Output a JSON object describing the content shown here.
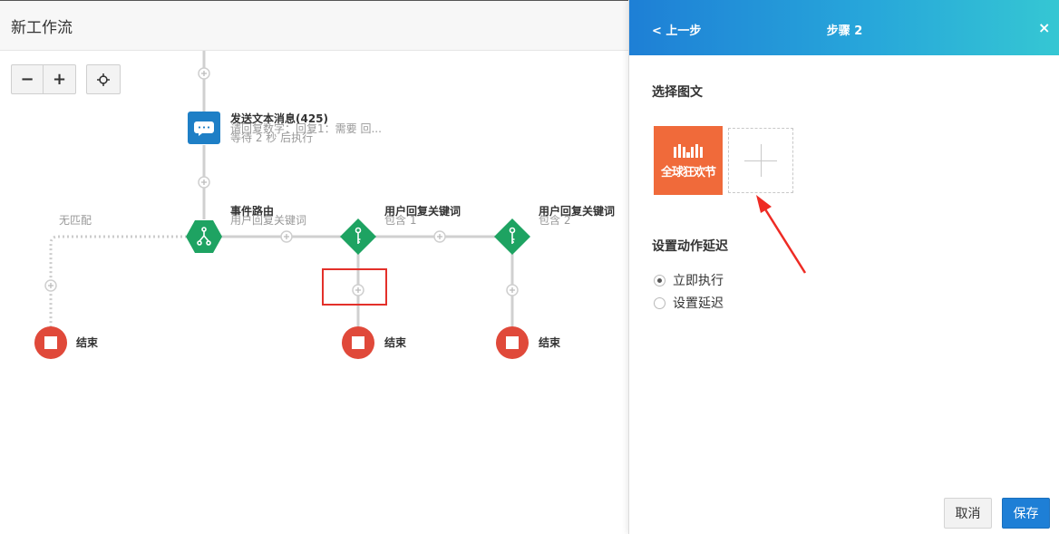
{
  "workflow": {
    "title": "新工作流",
    "controls": {
      "zoom_out": "−",
      "zoom_in": "+"
    },
    "nodes": {
      "send_message": {
        "title": "发送文本消息(425)",
        "detail": "请回复数字：回复1：需要 回...",
        "delay": "等待 2 秒 后执行",
        "icon": "chat-bubble-icon",
        "color": "#1e7fc6"
      },
      "event_router": {
        "title": "事件路由",
        "subtitle": "用户回复关键词",
        "icon": "branch-icon",
        "color": "#1ea362"
      },
      "keyword_1": {
        "title": "用户回复关键词",
        "subtitle": "包含 1",
        "icon": "key-icon",
        "color": "#1ea362"
      },
      "keyword_2": {
        "title": "用户回复关键词",
        "subtitle": "包含 2",
        "icon": "key-icon",
        "color": "#1ea362"
      },
      "no_match_label": "无匹配",
      "end_nodes": [
        {
          "label": "结束",
          "color": "#e0493a"
        },
        {
          "label": "结束",
          "color": "#e0493a"
        },
        {
          "label": "结束",
          "color": "#e0493a"
        }
      ]
    }
  },
  "panel": {
    "back_label": "< 上一步",
    "step_title": "步骤 2",
    "close_label": "×",
    "media_section_title": "选择图文",
    "media_item_text": "全球狂欢节",
    "delay_section_title": "设置动作延迟",
    "delay_options": [
      {
        "label": "立即执行",
        "checked": true
      },
      {
        "label": "设置延迟",
        "checked": false
      }
    ],
    "cancel_label": "取消",
    "save_label": "保存",
    "header_colors": [
      "#1e7fd6",
      "#35c7d3"
    ],
    "save_color": "#1e7fd6"
  }
}
